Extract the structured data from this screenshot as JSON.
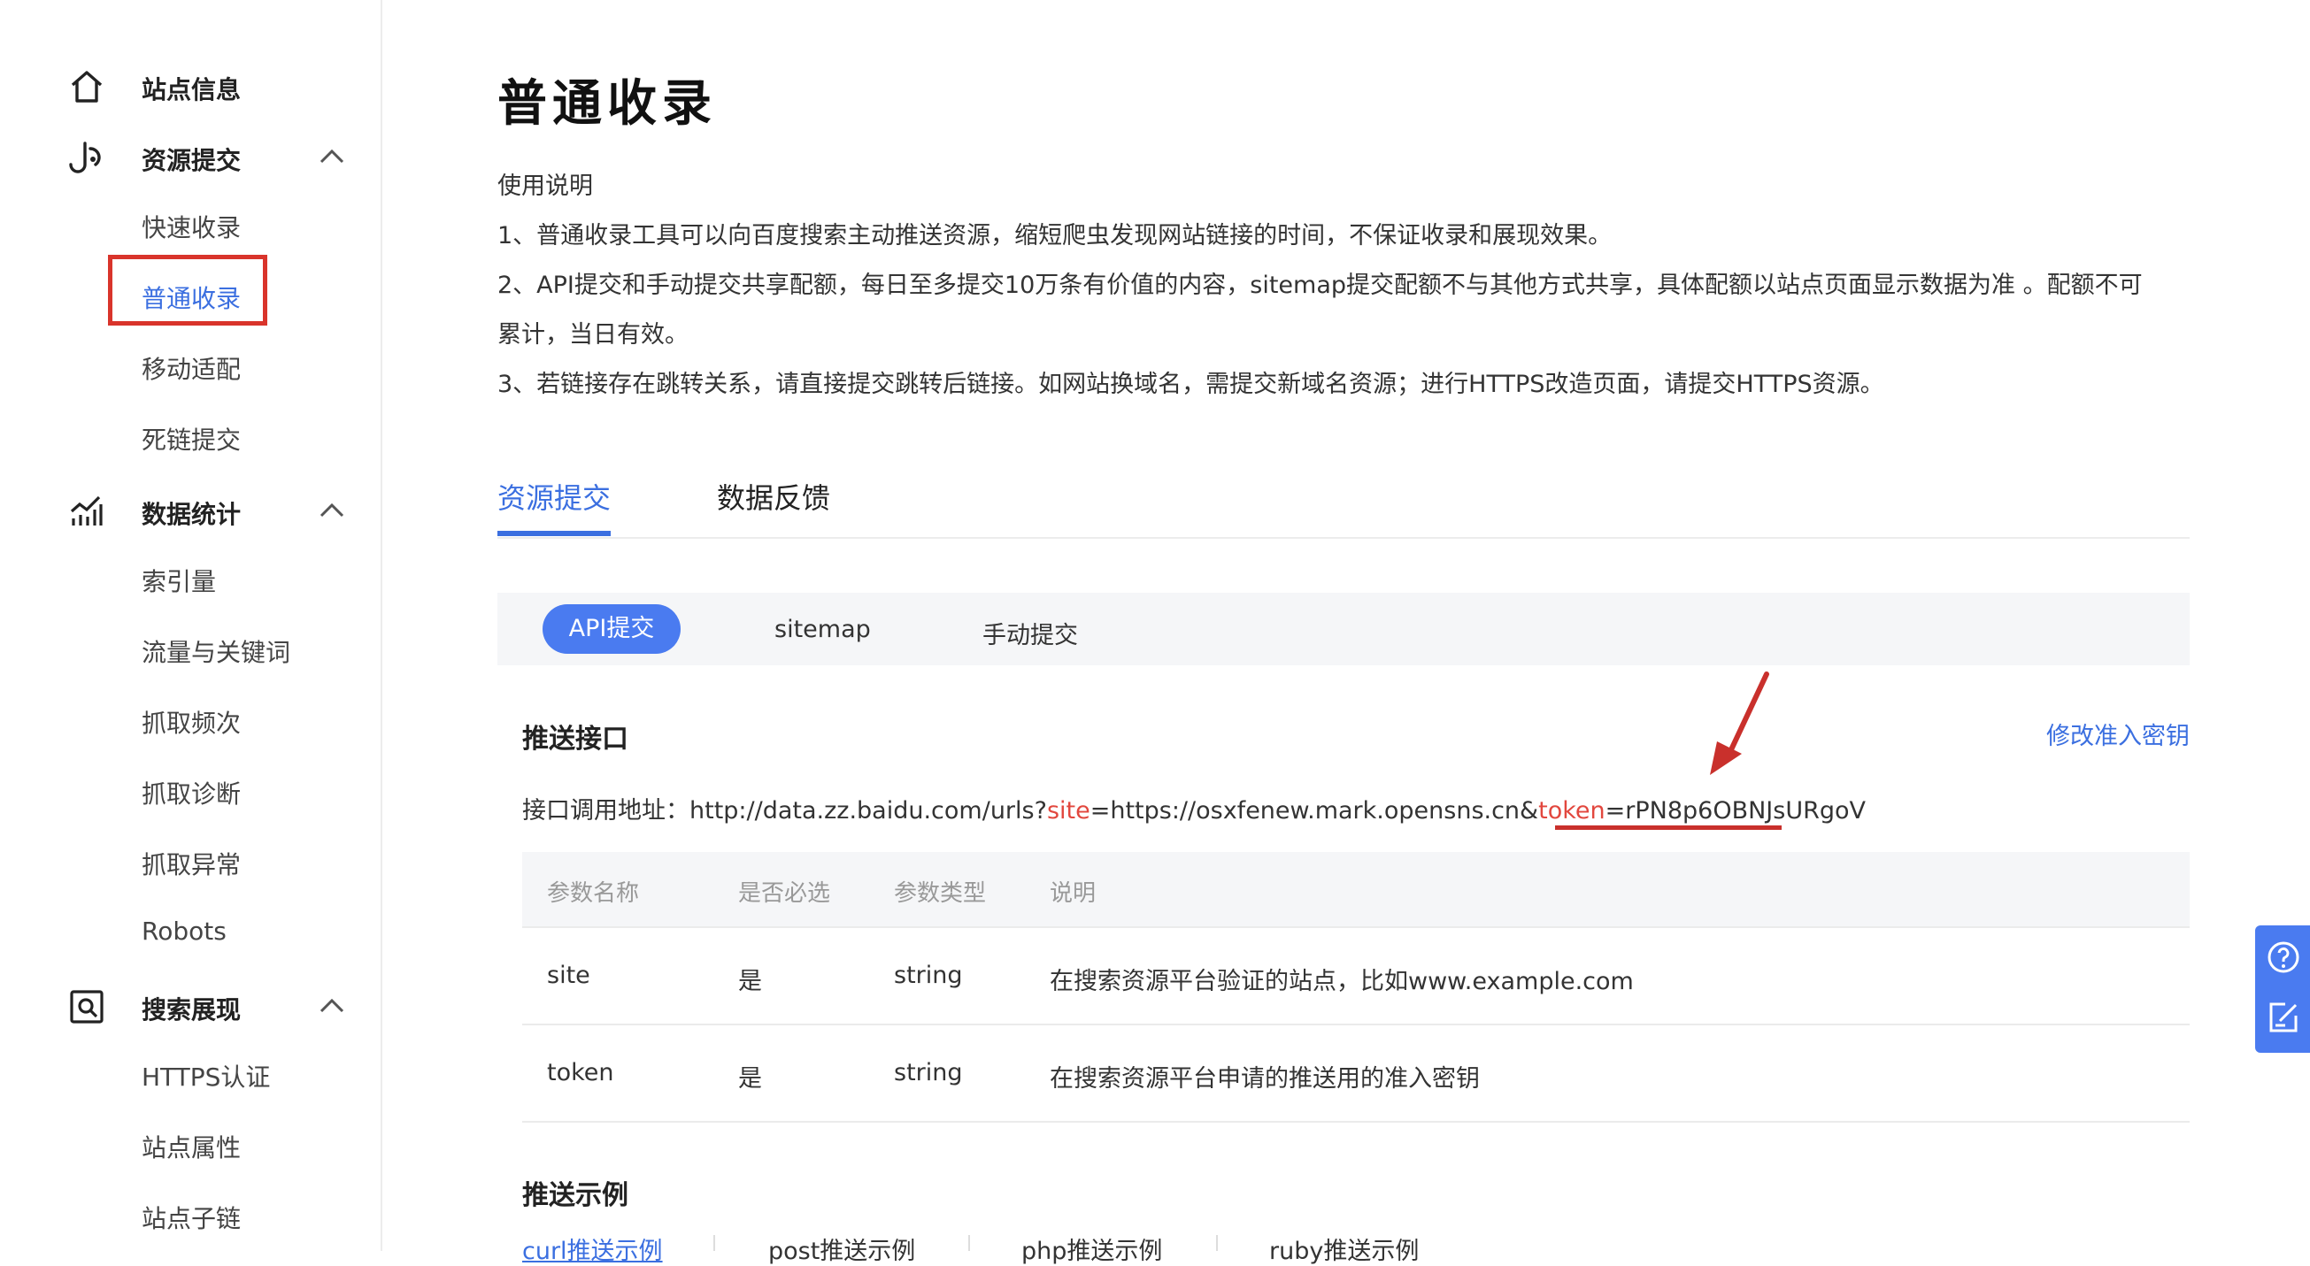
{
  "sidebar": {
    "groups": [
      {
        "label": "站点信息",
        "icon": "home-icon"
      },
      {
        "label": "资源提交",
        "icon": "submit-icon",
        "expanded": true,
        "items": [
          "快速收录",
          "普通收录",
          "移动适配",
          "死链提交"
        ]
      },
      {
        "label": "数据统计",
        "icon": "chart-icon",
        "expanded": true,
        "items": [
          "索引量",
          "流量与关键词",
          "抓取频次",
          "抓取诊断",
          "抓取异常",
          "Robots"
        ]
      },
      {
        "label": "搜索展现",
        "icon": "search-display-icon",
        "expanded": true,
        "items": [
          "HTTPS认证",
          "站点属性",
          "站点子链"
        ]
      }
    ],
    "active_item": "普通收录"
  },
  "main": {
    "title": "普通收录",
    "usage_heading": "使用说明",
    "usage_lines": [
      "1、普通收录工具可以向百度搜索主动推送资源，缩短爬虫发现网站链接的时间，不保证收录和展现效果。",
      "2、API提交和手动提交共享配额，每日至多提交10万条有价值的内容，sitemap提交配额不与其他方式共享，具体配额以站点页面显示数据为准 。配额不可",
      "累计，当日有效。",
      "3、若链接存在跳转关系，请直接提交跳转后链接。如网站换域名，需提交新域名资源；进行HTTPS改造页面，请提交HTTPS资源。"
    ],
    "tabs": [
      {
        "label": "资源提交",
        "active": true
      },
      {
        "label": "数据反馈",
        "active": false
      }
    ],
    "subtabs": [
      {
        "label": "API提交",
        "active": true
      },
      {
        "label": "sitemap",
        "active": false
      },
      {
        "label": "手动提交",
        "active": false
      }
    ],
    "push_section": {
      "title": "推送接口",
      "edit_key_link": "修改准入密钥",
      "endpoint_label": "接口调用地址：",
      "endpoint_base": "http://data.zz.baidu.com/urls?",
      "param_site": "site",
      "site_value": "=https://osxfenew.mark.opensns.cn&",
      "param_token": "token",
      "token_value": "=rPN8p6OBNJsURgoV"
    },
    "param_table": {
      "headers": [
        "参数名称",
        "是否必选",
        "参数类型",
        "说明"
      ],
      "rows": [
        [
          "site",
          "是",
          "string",
          "在搜索资源平台验证的站点，比如www.example.com"
        ],
        [
          "token",
          "是",
          "string",
          "在搜索资源平台申请的推送用的准入密钥"
        ]
      ]
    },
    "example_section": {
      "title": "推送示例",
      "tabs": [
        "curl推送示例",
        "post推送示例",
        "php推送示例",
        "ruby推送示例"
      ]
    }
  },
  "floating_tools": [
    "help-icon",
    "feedback-edit-icon"
  ],
  "colors": {
    "accent": "#3b6fe0",
    "highlight_red": "#d9342b",
    "param_red": "#e2473e"
  }
}
